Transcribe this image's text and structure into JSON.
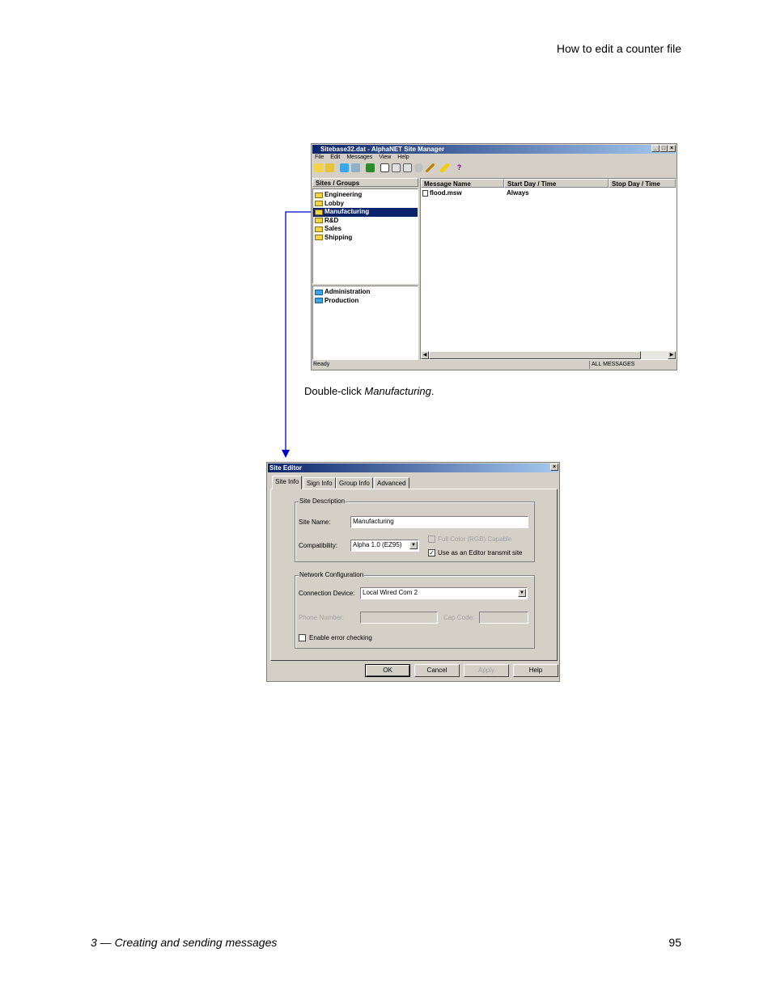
{
  "page": {
    "header": "How to edit a counter file",
    "footer_left": "3 — Creating and sending messages",
    "footer_right": "95",
    "caption_prefix": "Double-click ",
    "caption_italic": "Manufacturing",
    "caption_suffix": "."
  },
  "site_manager": {
    "title": "Sitebase32.dat - AlphaNET Site Manager",
    "menu": [
      "File",
      "Edit",
      "Messages",
      "View",
      "Help"
    ],
    "sites_header": "Sites / Groups",
    "sites": [
      "Engineering",
      "Lobby",
      "Manufacturing",
      "R&D",
      "Sales",
      "Shipping"
    ],
    "groups": [
      "Administration",
      "Production"
    ],
    "columns": [
      "Message Name",
      "Start Day / Time",
      "Stop Day / Time"
    ],
    "rows": [
      {
        "name": "flood.msw",
        "start": "Always",
        "stop": ""
      }
    ],
    "status_left": "Ready",
    "status_right": "ALL MESSAGES"
  },
  "site_editor": {
    "title": "Site Editor",
    "tabs": [
      "Site Info",
      "Sign Info",
      "Group Info",
      "Advanced"
    ],
    "site_description_title": "Site Description",
    "site_name_label": "Site Name:",
    "site_name_value": "Manufacturing",
    "compat_label": "Compatibility:",
    "compat_value": "Alpha 1.0 (EZ95)",
    "full_color_label": "Full Color (RGB) Capable",
    "editor_transmit_label": "Use as an Editor transmit site",
    "network_title": "Network Configuration",
    "conn_label": "Connection Device:",
    "conn_value": "Local Wired Com 2",
    "phone_label": "Phone Number:",
    "cap_label": "Cap Code:",
    "error_check_label": "Enable error checking",
    "buttons": {
      "ok": "OK",
      "cancel": "Cancel",
      "apply": "Apply",
      "help": "Help"
    }
  }
}
